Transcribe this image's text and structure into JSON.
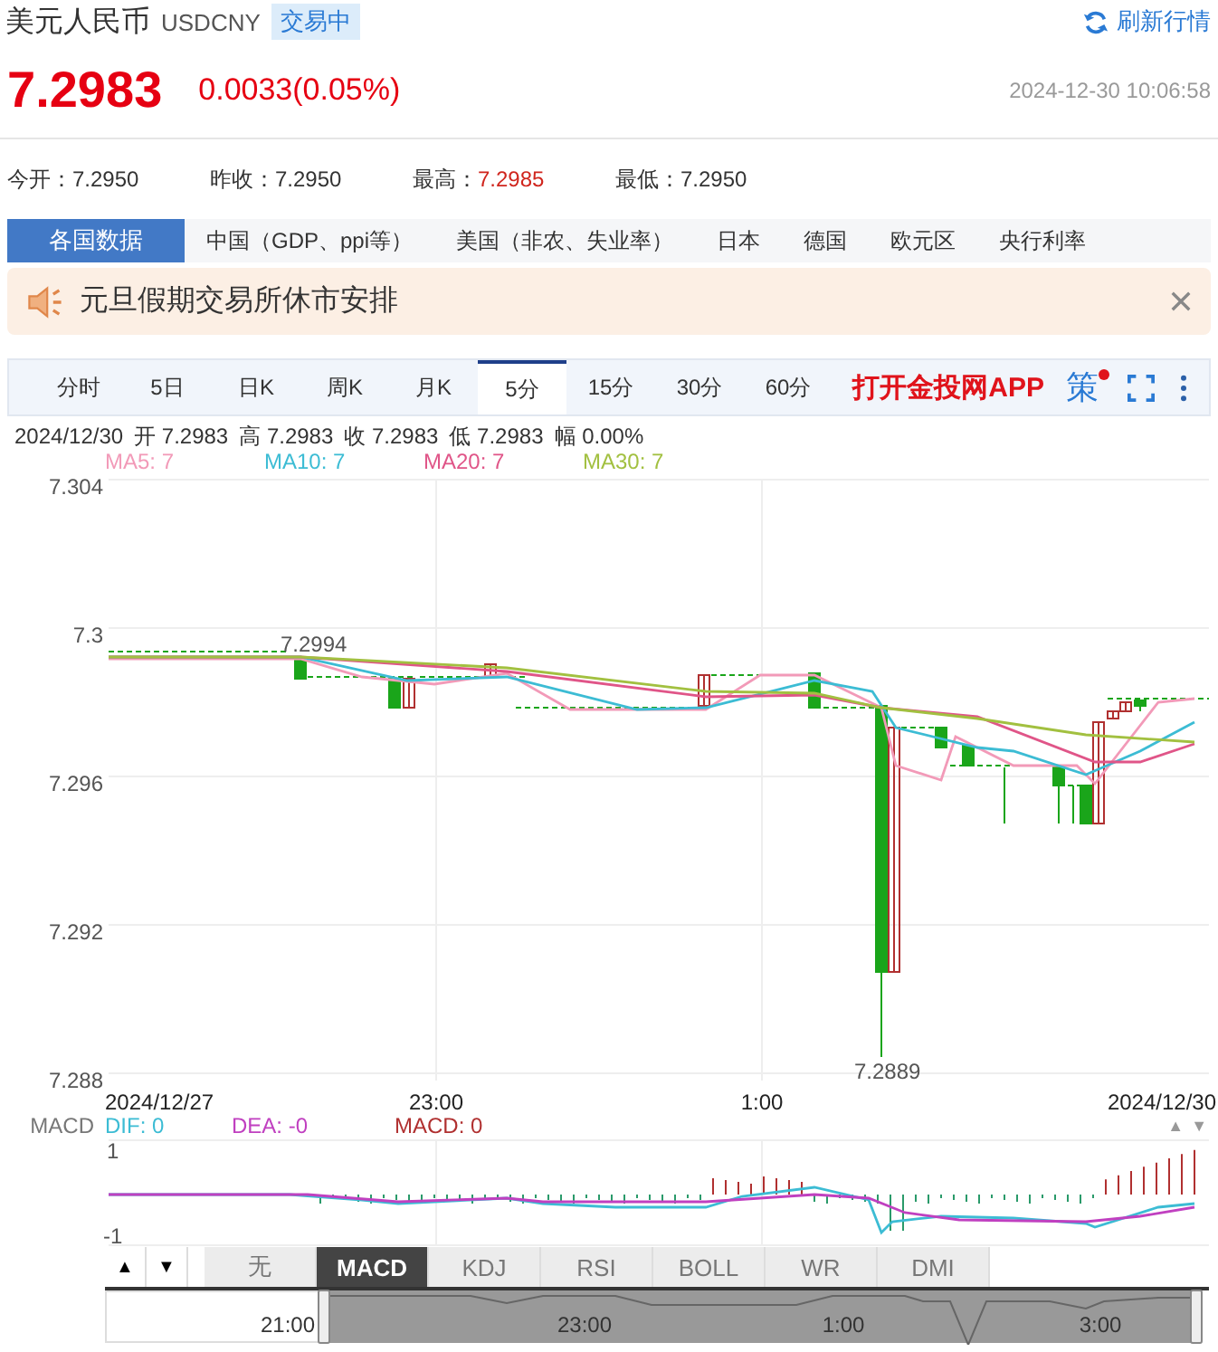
{
  "header": {
    "name": "美元人民币",
    "code": "USDCNY",
    "status": "交易中",
    "refresh": "刷新行情"
  },
  "quote": {
    "price": "7.2983",
    "change": "0.0033(0.05%)",
    "time": "2024-12-30 10:06:58"
  },
  "stats": [
    {
      "label": "今开：",
      "value": "7.2950",
      "kind": "plain"
    },
    {
      "label": "昨收：",
      "value": "7.2950",
      "kind": "plain"
    },
    {
      "label": "最高：",
      "value": "7.2985",
      "kind": "up"
    },
    {
      "label": "最低：",
      "value": "7.2950",
      "kind": "plain"
    }
  ],
  "data_tabs": [
    {
      "label": "各国数据",
      "selected": true
    },
    {
      "label": "中国（GDP、ppi等）",
      "selected": false
    },
    {
      "label": "美国（非农、失业率）",
      "selected": false
    },
    {
      "label": "日本",
      "selected": false
    },
    {
      "label": "德国",
      "selected": false
    },
    {
      "label": "欧元区",
      "selected": false
    },
    {
      "label": "央行利率",
      "selected": false
    }
  ],
  "notice": {
    "text": "元旦假期交易所休市安排"
  },
  "period_tabs": [
    {
      "label": "分时",
      "selected": false
    },
    {
      "label": "5日",
      "selected": false
    },
    {
      "label": "日K",
      "selected": false
    },
    {
      "label": "周K",
      "selected": false
    },
    {
      "label": "月K",
      "selected": false
    },
    {
      "label": "5分",
      "selected": true
    },
    {
      "label": "15分",
      "selected": false
    },
    {
      "label": "30分",
      "selected": false
    },
    {
      "label": "60分",
      "selected": false
    }
  ],
  "app_link": "打开金投网APP",
  "strategy": {
    "label": "策",
    "dot": true
  },
  "ohlc": [
    "2024/12/30",
    "开 7.2983",
    "高 7.2983",
    "收 7.2983",
    "低 7.2983",
    "幅 0.00%"
  ],
  "ma_legend": [
    {
      "label": "MA5: 7",
      "color": "#f29ab8"
    },
    {
      "label": "MA10: 7",
      "color": "#3cbcd4"
    },
    {
      "label": "MA20: 7",
      "color": "#e05588"
    },
    {
      "label": "MA30: 7",
      "color": "#a2c040"
    }
  ],
  "chart": {
    "y_labels": [
      "7.304",
      "7.3",
      "7.296",
      "7.292",
      "7.288"
    ],
    "x_labels": [
      "2024/12/27",
      "23:00",
      "1:00",
      "2024/12/30"
    ],
    "high_label": "7.2994",
    "low_label": "7.2889"
  },
  "macd": {
    "title": "MACD",
    "legend": [
      {
        "label": "DIF: 0",
        "color": "#3cbcd4"
      },
      {
        "label": "DEA: -0",
        "color": "#c040c0"
      },
      {
        "label": "MACD: 0",
        "color": "#b03030"
      }
    ],
    "y_labels": [
      "1",
      "-1"
    ],
    "scroll_arrows": [
      "▲",
      "▼"
    ]
  },
  "move_buttons": [
    "▲",
    "▼"
  ],
  "indicator_tabs": [
    {
      "label": "无",
      "selected": false
    },
    {
      "label": "MACD",
      "selected": true
    },
    {
      "label": "KDJ",
      "selected": false
    },
    {
      "label": "RSI",
      "selected": false
    },
    {
      "label": "BOLL",
      "selected": false
    },
    {
      "label": "WR",
      "selected": false
    },
    {
      "label": "DMI",
      "selected": false
    }
  ],
  "navigator": {
    "labels": [
      "21:00",
      "23:00",
      "1:00",
      "3:00"
    ]
  }
}
